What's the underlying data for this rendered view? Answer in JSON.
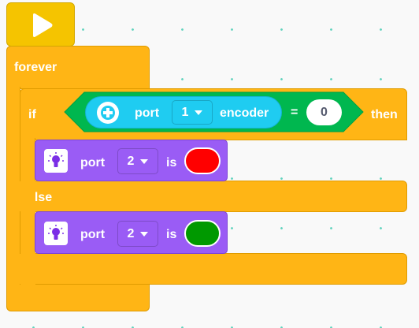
{
  "blocks": {
    "start": {
      "icon": "play-icon",
      "color": "#f5c400"
    },
    "forever": {
      "label": "forever",
      "color": "#ffb515"
    },
    "if_else": {
      "if_label": "if",
      "then_label": "then",
      "else_label": "else"
    },
    "condition": {
      "operator": "=",
      "value": "0",
      "color": "#00b74f",
      "sensor": {
        "icon": "motor-plus-icon",
        "port_label": "port",
        "port_value": "1",
        "measure": "encoder",
        "color": "#1fccf1"
      }
    },
    "light_1": {
      "icon": "lightbulb-icon",
      "port_label": "port",
      "port_value": "2",
      "is_label": "is",
      "color_value": "#ff0000"
    },
    "light_2": {
      "icon": "lightbulb-icon",
      "port_label": "port",
      "port_value": "2",
      "is_label": "is",
      "color_value": "#009900"
    },
    "action_color": "#9a5cf5"
  }
}
